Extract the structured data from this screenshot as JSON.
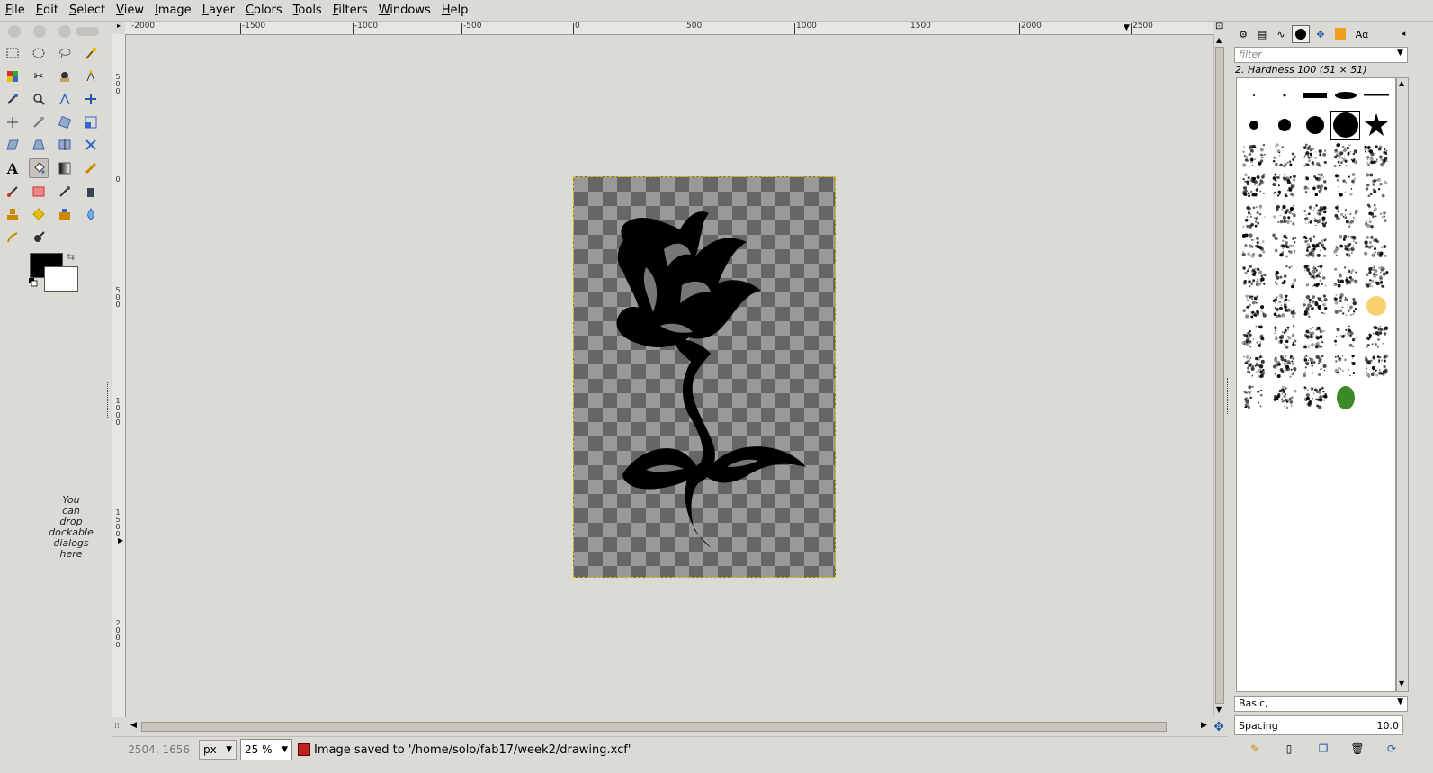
{
  "menubar": {
    "items": [
      "File",
      "Edit",
      "Select",
      "View",
      "Image",
      "Layer",
      "Colors",
      "Tools",
      "Filters",
      "Windows",
      "Help"
    ]
  },
  "toolbox": {
    "drop_hint": "You\ncan\ndrop\ndockable\ndialogs\nhere",
    "foreground_color": "#000000",
    "background_color": "#ffffff"
  },
  "rulers": {
    "top_labels": [
      "-2000",
      "-1500",
      "-1000",
      "-500",
      "0",
      "500",
      "1000",
      "1500",
      "2000",
      "2500"
    ],
    "left_labels": [
      "5\n0\n0",
      "0",
      "5\n0\n0",
      "1\n0\n0\n0",
      "1\n5\n0\n0",
      "2\n0\n0\n0"
    ]
  },
  "statusbar": {
    "coordinates": "2504, 1656",
    "unit": "px",
    "zoom": "25 %",
    "message": "Image saved to '/home/solo/fab17/week2/drawing.xcf'"
  },
  "dock": {
    "filter_placeholder": "filter",
    "brush_name": "2. Hardness 100 (51 × 51)",
    "tag": "Basic,",
    "spacing_label": "Spacing",
    "spacing_value": "10.0"
  }
}
